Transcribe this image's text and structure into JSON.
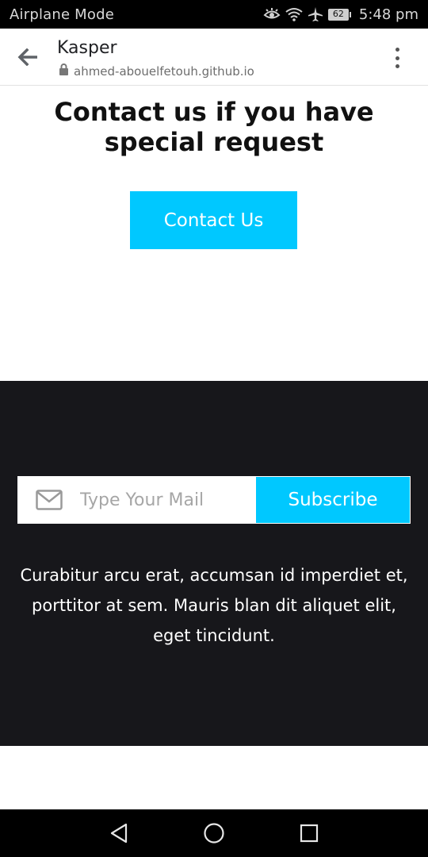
{
  "status_bar": {
    "left_text": "Airplane Mode",
    "battery": "62",
    "time": "5:48 pm",
    "icons": [
      "eye-comfort-icon",
      "wifi-icon",
      "airplane-icon",
      "battery-icon"
    ]
  },
  "browser": {
    "title": "Kasper",
    "url": "ahmed-abouelfetouh.github.io",
    "icons": [
      "back-arrow-icon",
      "lock-icon",
      "more-vert-icon"
    ]
  },
  "contact": {
    "heading": "Contact us if you have special request",
    "button_label": "Contact Us"
  },
  "footer": {
    "mail_placeholder": "Type Your Mail",
    "subscribe_label": "Subscribe",
    "text": "Curabitur arcu erat, accumsan id imperdiet et, porttitor at sem. Mauris blan dit aliquet elit, eget tincidunt."
  },
  "nav_bar": {
    "icons": [
      "nav-back-icon",
      "nav-home-icon",
      "nav-recents-icon"
    ]
  },
  "colors": {
    "accent": "#00c8ff",
    "footer_bg": "#17171b"
  }
}
